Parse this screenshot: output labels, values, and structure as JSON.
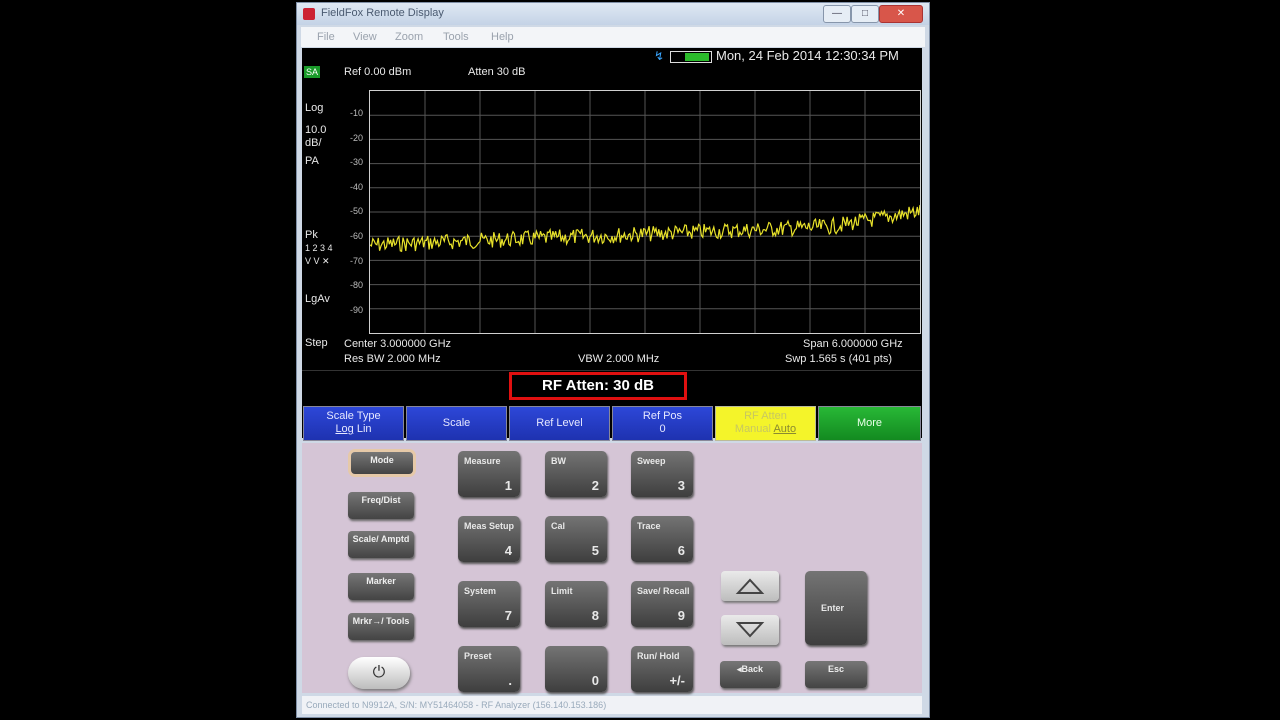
{
  "window": {
    "title": "FieldFox Remote Display",
    "controls": [
      "—",
      "□",
      "✕"
    ]
  },
  "menu": [
    "File",
    "View",
    "Zoom",
    "Tools",
    "Help"
  ],
  "screen": {
    "mode_badge": "SA",
    "ref_level": "Ref 0.00 dBm",
    "atten": "Atten 30 dB",
    "datetime": "Mon, 24 Feb 2014 12:30:34 PM",
    "left_labels": {
      "scale_mode": "Log",
      "scale_value": "10.0",
      "scale_unit": "dB/",
      "pa": "PA",
      "detector": "Pk",
      "trace_nums": "1 2 3 4",
      "trace_modes": "V V ✕",
      "average": "LgAv",
      "step": "Step"
    },
    "y_ticks": [
      "-10",
      "-20",
      "-30",
      "-40",
      "-50",
      "-60",
      "-70",
      "-80",
      "-90"
    ],
    "center": "Center 3.000000 GHz",
    "span": "Span 6.000000 GHz",
    "res_bw": "Res BW 2.000 MHz",
    "vbw": "VBW 2.000 MHz",
    "sweep": "Swp 1.565 s (401 pts)",
    "status_value": "RF Atten:  30 dB"
  },
  "softkeys": [
    {
      "line1": "Scale Type",
      "line2a": "Log",
      "line2b": " Lin"
    },
    {
      "label": "Scale"
    },
    {
      "label": "Ref Level"
    },
    {
      "line1": "Ref Pos",
      "line2": "0"
    },
    {
      "line1": "RF Atten",
      "line2a": "Manual ",
      "line2b": "Auto"
    },
    {
      "label": "More"
    }
  ],
  "panel": {
    "left_keys": [
      "Mode",
      "Freq/Dist",
      "Scale/ Amptd",
      "Marker",
      "Mrkr→/ Tools"
    ],
    "grid_keys": [
      {
        "label": "Measure",
        "num": "1"
      },
      {
        "label": "BW",
        "num": "2"
      },
      {
        "label": "Sweep",
        "num": "3"
      },
      {
        "label": "Meas Setup",
        "num": "4"
      },
      {
        "label": "Cal",
        "num": "5"
      },
      {
        "label": "Trace",
        "num": "6"
      },
      {
        "label": "System",
        "num": "7"
      },
      {
        "label": "Limit",
        "num": "8"
      },
      {
        "label": "Save/ Recall",
        "num": "9"
      },
      {
        "label": "Preset",
        "num": "."
      },
      {
        "label": "",
        "num": "0"
      },
      {
        "label": "Run/ Hold",
        "num": "+/-"
      }
    ],
    "enter": "Enter",
    "back": "◂Back",
    "esc": "Esc"
  },
  "footer": "Connected to N9912A, S/N: MY51464058 - RF Analyzer (156.140.153.186)",
  "colors": {
    "trace": "#e8e22a",
    "softkey_blue": "#2a40cc",
    "softkey_yellow": "#f4f42a",
    "softkey_green": "#1fa52a",
    "atten_border": "#e01010",
    "panel": "#d5c5d6"
  }
}
